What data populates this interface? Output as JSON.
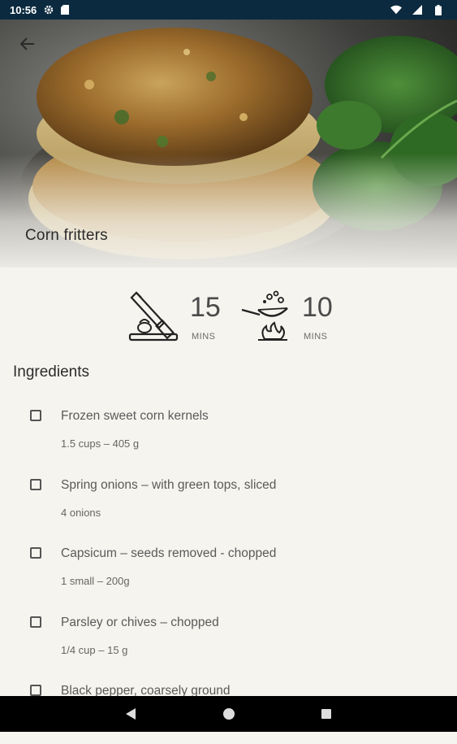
{
  "status_bar": {
    "time": "10:56",
    "icons": [
      "gear-icon",
      "sd-card-icon",
      "wifi-icon",
      "signal-icon",
      "battery-icon"
    ]
  },
  "header": {
    "title": "Corn fritters",
    "back_icon": "arrow-left-icon"
  },
  "times": {
    "prep": {
      "icon": "knife-board-icon",
      "value": "15",
      "unit": "MINS"
    },
    "cook": {
      "icon": "frying-pan-icon",
      "value": "10",
      "unit": "MINS"
    }
  },
  "ingredients": {
    "title": "Ingredients",
    "items": [
      {
        "name": "Frozen sweet corn kernels",
        "qty": "1.5 cups – 405 g"
      },
      {
        "name": "Spring onions – with green tops, sliced",
        "qty": "4 onions"
      },
      {
        "name": "Capsicum – seeds removed - chopped",
        "qty": "1 small – 200g"
      },
      {
        "name": "Parsley or chives – chopped",
        "qty": "1/4 cup – 15 g"
      },
      {
        "name": "Black pepper, coarsely ground",
        "qty": ""
      }
    ]
  },
  "nav": {
    "back": "triangle-back-icon",
    "home": "circle-home-icon",
    "recents": "square-recents-icon"
  },
  "colors": {
    "status_bar": "#0b2a3f",
    "background": "#f6f4ee",
    "nav_bar": "#000000"
  }
}
